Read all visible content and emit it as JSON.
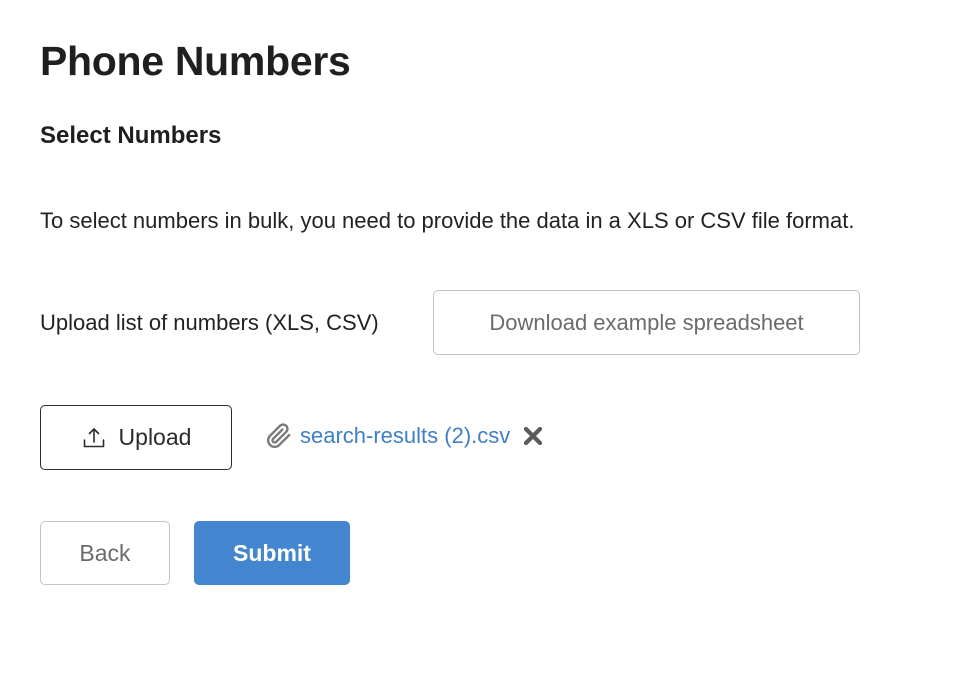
{
  "page": {
    "title": "Phone Numbers"
  },
  "section": {
    "title": "Select Numbers",
    "description": "To select numbers in bulk, you need to provide the data in a XLS or CSV file format."
  },
  "upload": {
    "label": "Upload list of numbers (XLS, CSV)",
    "download_example_label": "Download example spreadsheet",
    "upload_button_label": "Upload",
    "upload_icon": "upload-icon",
    "selected_file": {
      "name": "search-results (2).csv",
      "attachment_icon": "paperclip-icon",
      "remove_icon": "close-icon"
    }
  },
  "actions": {
    "back_label": "Back",
    "submit_label": "Submit"
  },
  "colors": {
    "primary": "#4485cf",
    "link": "#3f7fc4",
    "border_muted": "#c4c4c4",
    "border_dark": "#2b2b2b",
    "text": "#222222"
  }
}
